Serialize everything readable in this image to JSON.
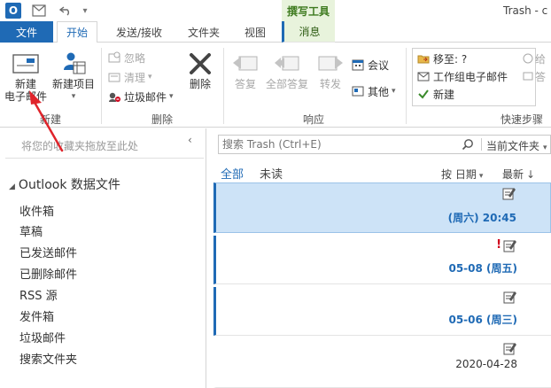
{
  "window": {
    "title": "Trash - c"
  },
  "tool_group": "撰写工具",
  "tabs": [
    "文件",
    "开始",
    "发送/接收",
    "文件夹",
    "视图",
    "消息"
  ],
  "ribbon": {
    "new_group": {
      "label": "新建",
      "new_email_line1": "新建",
      "new_email_line2": "电子邮件",
      "new_items": "新建项目"
    },
    "delete_group": {
      "label": "删除",
      "ignore": "忽略",
      "cleanup": "清理",
      "junk": "垃圾邮件",
      "delete": "删除"
    },
    "respond_group": {
      "label": "响应",
      "reply": "答复",
      "reply_all": "全部答复",
      "forward": "转发",
      "meeting": "会议",
      "more": "其他"
    },
    "quicksteps_group": {
      "label": "快速步骤",
      "move_to": "移至: ?",
      "team_email": "工作组电子邮件",
      "new": "新建",
      "right_top": "给",
      "right_mid": "答"
    }
  },
  "nav": {
    "favorites_hint": "将您的收藏夹拖放至此处",
    "account": "Outlook 数据文件",
    "folders": [
      "收件箱",
      "草稿",
      "已发送邮件",
      "已删除邮件",
      "RSS 源",
      "发件箱",
      "垃圾邮件",
      "搜索文件夹"
    ]
  },
  "search": {
    "placeholder": "搜索 Trash (Ctrl+E)",
    "scope": "当前文件夹"
  },
  "filters": {
    "all": "全部",
    "unread": "未读",
    "sort_by": "按 日期",
    "sort_order": "最新"
  },
  "messages": [
    {
      "date": "(周六) 20:45",
      "flag": ""
    },
    {
      "date": "05-08 (周五)",
      "flag": "!"
    },
    {
      "date": "05-06 (周三)",
      "flag": ""
    },
    {
      "date": "2020-04-28",
      "flag": ""
    }
  ],
  "colors": {
    "accent": "#1f6ab5",
    "tool_group_bg": "#e8f3dc",
    "selected_bg": "#cde3f7",
    "annotation": "#e0242b"
  }
}
